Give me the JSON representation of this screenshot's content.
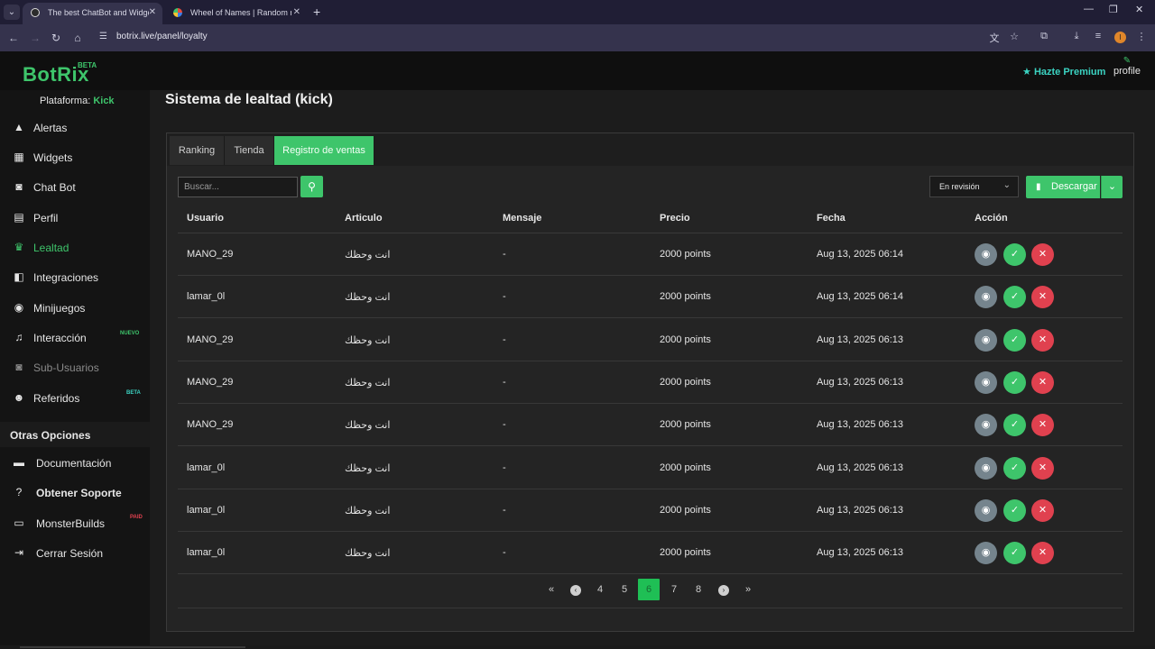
{
  "browser": {
    "tabs": [
      {
        "title": "The best ChatBot and Widgets",
        "active": true
      },
      {
        "title": "Wheel of Names | Random name",
        "active": false
      }
    ],
    "url": "botrix.live/panel/loyalty",
    "avatar_letter": "I"
  },
  "header": {
    "logo": "BotRix",
    "logo_badge": "BETA",
    "premium_label": "Hazte Premium",
    "profile_label": "profile"
  },
  "sidebar": {
    "platform_label": "Plataforma:",
    "platform_value": "Kick",
    "items": [
      {
        "label": "Alertas",
        "icon": "warning-icon"
      },
      {
        "label": "Widgets",
        "icon": "widgets-icon"
      },
      {
        "label": "Chat Bot",
        "icon": "robot-icon"
      },
      {
        "label": "Perfil",
        "icon": "profile-card-icon"
      },
      {
        "label": "Lealtad",
        "icon": "trophy-icon",
        "active": true
      },
      {
        "label": "Integraciones",
        "icon": "integrations-icon"
      },
      {
        "label": "Minijuegos",
        "icon": "gamepad-icon"
      },
      {
        "label": "Interacción",
        "icon": "music-icon",
        "badge": "NUEVO"
      },
      {
        "label": "Sub-Usuarios",
        "icon": "robot-icon",
        "disabled": true
      },
      {
        "label": "Referidos",
        "icon": "users-icon",
        "badge": "BETA"
      }
    ],
    "other_title": "Otras Opciones",
    "options": [
      {
        "label": "Documentación",
        "icon": "docs-icon"
      },
      {
        "label": "Obtener Soporte",
        "icon": "help-icon"
      },
      {
        "label": "MonsterBuilds",
        "icon": "laptop-icon",
        "badge": "PAID"
      },
      {
        "label": "Cerrar Sesión",
        "icon": "logout-icon"
      }
    ]
  },
  "main": {
    "title": "Sistema de lealtad (kick)",
    "tabs": [
      "Ranking",
      "Tienda",
      "Registro de ventas"
    ],
    "search_placeholder": "Buscar...",
    "status_filter": "En revisión",
    "download_label": "Descargar",
    "columns": [
      "Usuario",
      "Articulo",
      "Mensaje",
      "Precio",
      "Fecha",
      "Acción"
    ],
    "rows": [
      {
        "user": "MANO_29",
        "item": "انت وحظك",
        "message": "-",
        "price": "2000 points",
        "date": "Aug 13, 2025 06:14"
      },
      {
        "user": "lamar_0l",
        "item": "انت وحظك",
        "message": "-",
        "price": "2000 points",
        "date": "Aug 13, 2025 06:14"
      },
      {
        "user": "MANO_29",
        "item": "انت وحظك",
        "message": "-",
        "price": "2000 points",
        "date": "Aug 13, 2025 06:13"
      },
      {
        "user": "MANO_29",
        "item": "انت وحظك",
        "message": "-",
        "price": "2000 points",
        "date": "Aug 13, 2025 06:13"
      },
      {
        "user": "MANO_29",
        "item": "انت وحظك",
        "message": "-",
        "price": "2000 points",
        "date": "Aug 13, 2025 06:13"
      },
      {
        "user": "lamar_0l",
        "item": "انت وحظك",
        "message": "-",
        "price": "2000 points",
        "date": "Aug 13, 2025 06:13"
      },
      {
        "user": "lamar_0l",
        "item": "انت وحظك",
        "message": "-",
        "price": "2000 points",
        "date": "Aug 13, 2025 06:13"
      },
      {
        "user": "lamar_0l",
        "item": "انت وحظك",
        "message": "-",
        "price": "2000 points",
        "date": "Aug 13, 2025 06:13"
      }
    ],
    "pagination": {
      "pages": [
        "4",
        "5",
        "6",
        "7",
        "8"
      ],
      "current": "6"
    }
  },
  "colors": {
    "accent": "#3ec56b",
    "danger": "#e0414f",
    "neutral_action": "#75848d",
    "premium": "#3bd3c2"
  }
}
